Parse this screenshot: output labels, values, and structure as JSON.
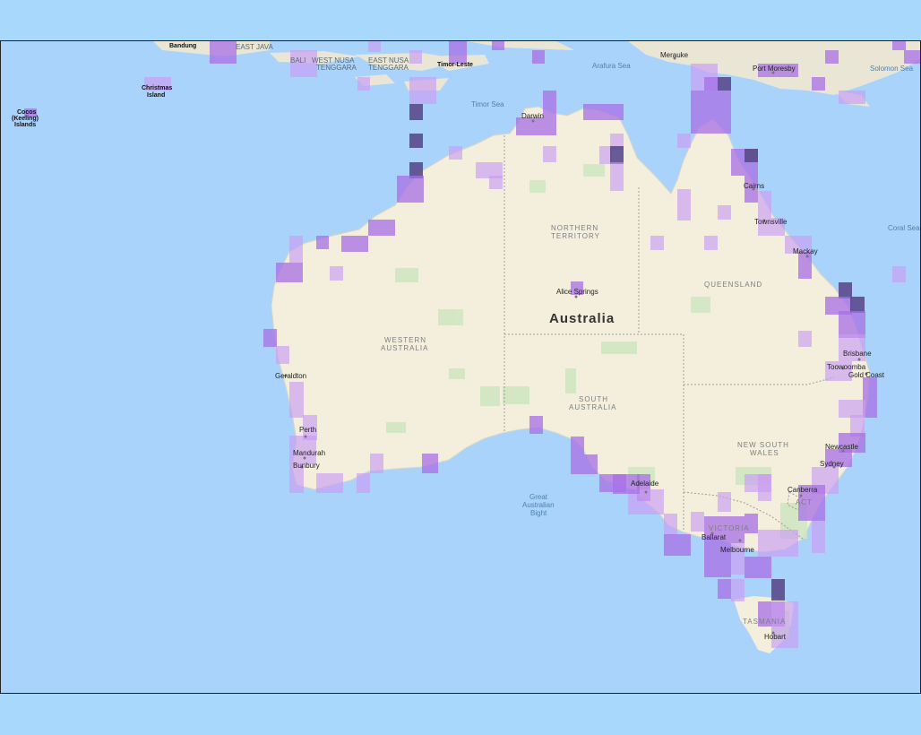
{
  "map": {
    "country_label": "Australia",
    "states": [
      {
        "id": "northern-territory",
        "lines": [
          "NORTHERN",
          "TERRITORY"
        ]
      },
      {
        "id": "western-australia",
        "lines": [
          "WESTERN",
          "AUSTRALIA"
        ]
      },
      {
        "id": "south-australia",
        "lines": [
          "SOUTH",
          "AUSTRALIA"
        ]
      },
      {
        "id": "queensland",
        "lines": [
          "QUEENSLAND"
        ]
      },
      {
        "id": "new-south-wales",
        "lines": [
          "NEW SOUTH",
          "WALES"
        ]
      },
      {
        "id": "victoria",
        "lines": [
          "VICTORIA"
        ]
      },
      {
        "id": "tasmania",
        "lines": [
          "TASMANIA"
        ]
      },
      {
        "id": "act",
        "lines": [
          "ACT"
        ]
      }
    ],
    "cities": [
      "Darwin",
      "Cairns",
      "Townsville",
      "Mackay",
      "Alice Springs",
      "Brisbane",
      "Toowoomba",
      "Gold Coast",
      "Newcastle",
      "Sydney",
      "Canberra",
      "Adelaide",
      "Melbourne",
      "Ballarat",
      "Hobart",
      "Perth",
      "Mandurah",
      "Bunbury",
      "Geraldton",
      "Port Moresby",
      "Merauke",
      "Timor-Leste",
      "Bandung"
    ],
    "water_bodies": [
      "Arafura Sea",
      "Timor Sea",
      "Coral Sea",
      "Solomon Sea",
      "Great Australian Bight"
    ],
    "islands": [
      [
        "Christmas",
        "Island"
      ],
      [
        "Cocos",
        "(Keeling)",
        "Islands"
      ]
    ],
    "region_labels": [
      "EAST JAVA",
      "BALI",
      "WEST NUSA",
      "TENGGARA",
      "EAST NUSA",
      "TENGGARA"
    ],
    "colors": {
      "ocean": "#aad3fb",
      "land": "#f4efdc",
      "land_alt": "#e9e6d6",
      "border": "#9e9e9e",
      "occurrence_light": "#c99bf2",
      "occurrence_mid": "#a76fe6",
      "occurrence_dark": "#5a4a8c"
    }
  }
}
